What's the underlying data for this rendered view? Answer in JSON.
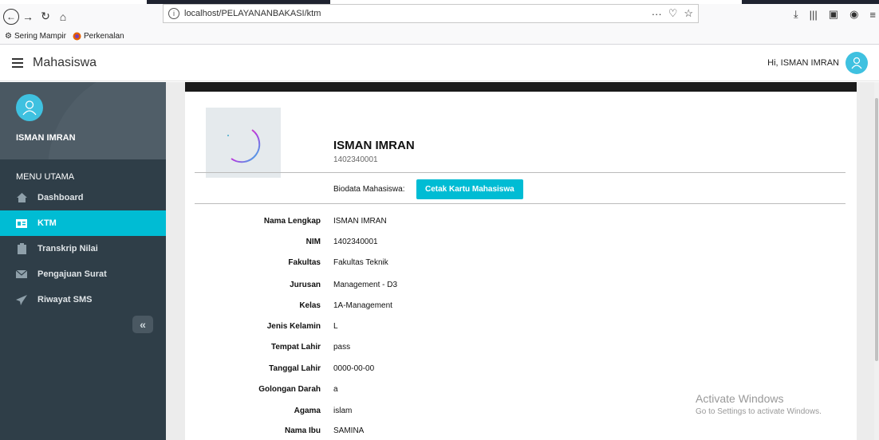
{
  "browser": {
    "url": "localhost/PELAYANANBAKASI/ktm",
    "bookmarks": [
      "Sering Mampir",
      "Perkenalan"
    ]
  },
  "header": {
    "title": "Mahasiswa",
    "greeting": "Hi, ISMAN IMRAN"
  },
  "sidebar": {
    "user_name": "ISMAN IMRAN",
    "menu_title": "MENU UTAMA",
    "items": [
      {
        "label": "Dashboard",
        "icon": "home-icon"
      },
      {
        "label": "KTM",
        "icon": "id-card-icon",
        "active": true
      },
      {
        "label": "Transkrip Nilai",
        "icon": "clipboard-icon"
      },
      {
        "label": "Pengajuan Surat",
        "icon": "mail-icon"
      },
      {
        "label": "Riwayat SMS",
        "icon": "send-icon"
      }
    ],
    "collapse_label": "«"
  },
  "profile": {
    "name": "ISMAN IMRAN",
    "nim": "1402340001",
    "biodata_label": "Biodata Mahasiswa:",
    "print_button": "Cetak Kartu Mahasiswa"
  },
  "details": [
    {
      "label": "Nama Lengkap",
      "value": "ISMAN IMRAN"
    },
    {
      "label": "NIM",
      "value": "1402340001"
    },
    {
      "label": "Fakultas",
      "value": "Fakultas Teknik"
    },
    {
      "label": "Jurusan",
      "value": "Management - D3"
    },
    {
      "label": "Kelas",
      "value": "1A-Management"
    },
    {
      "label": "Jenis Kelamin",
      "value": "L"
    },
    {
      "label": "Tempat Lahir",
      "value": "pass"
    },
    {
      "label": "Tanggal Lahir",
      "value": "0000-00-00"
    },
    {
      "label": "Golongan Darah",
      "value": "a"
    },
    {
      "label": "Agama",
      "value": "islam"
    },
    {
      "label": "Nama Ibu",
      "value": "SAMINA"
    }
  ],
  "watermark": {
    "line1": "Activate Windows",
    "line2": "Go to Settings to activate Windows."
  },
  "colors": {
    "accent": "#00bcd4",
    "sidebar": "#2f3e48"
  }
}
